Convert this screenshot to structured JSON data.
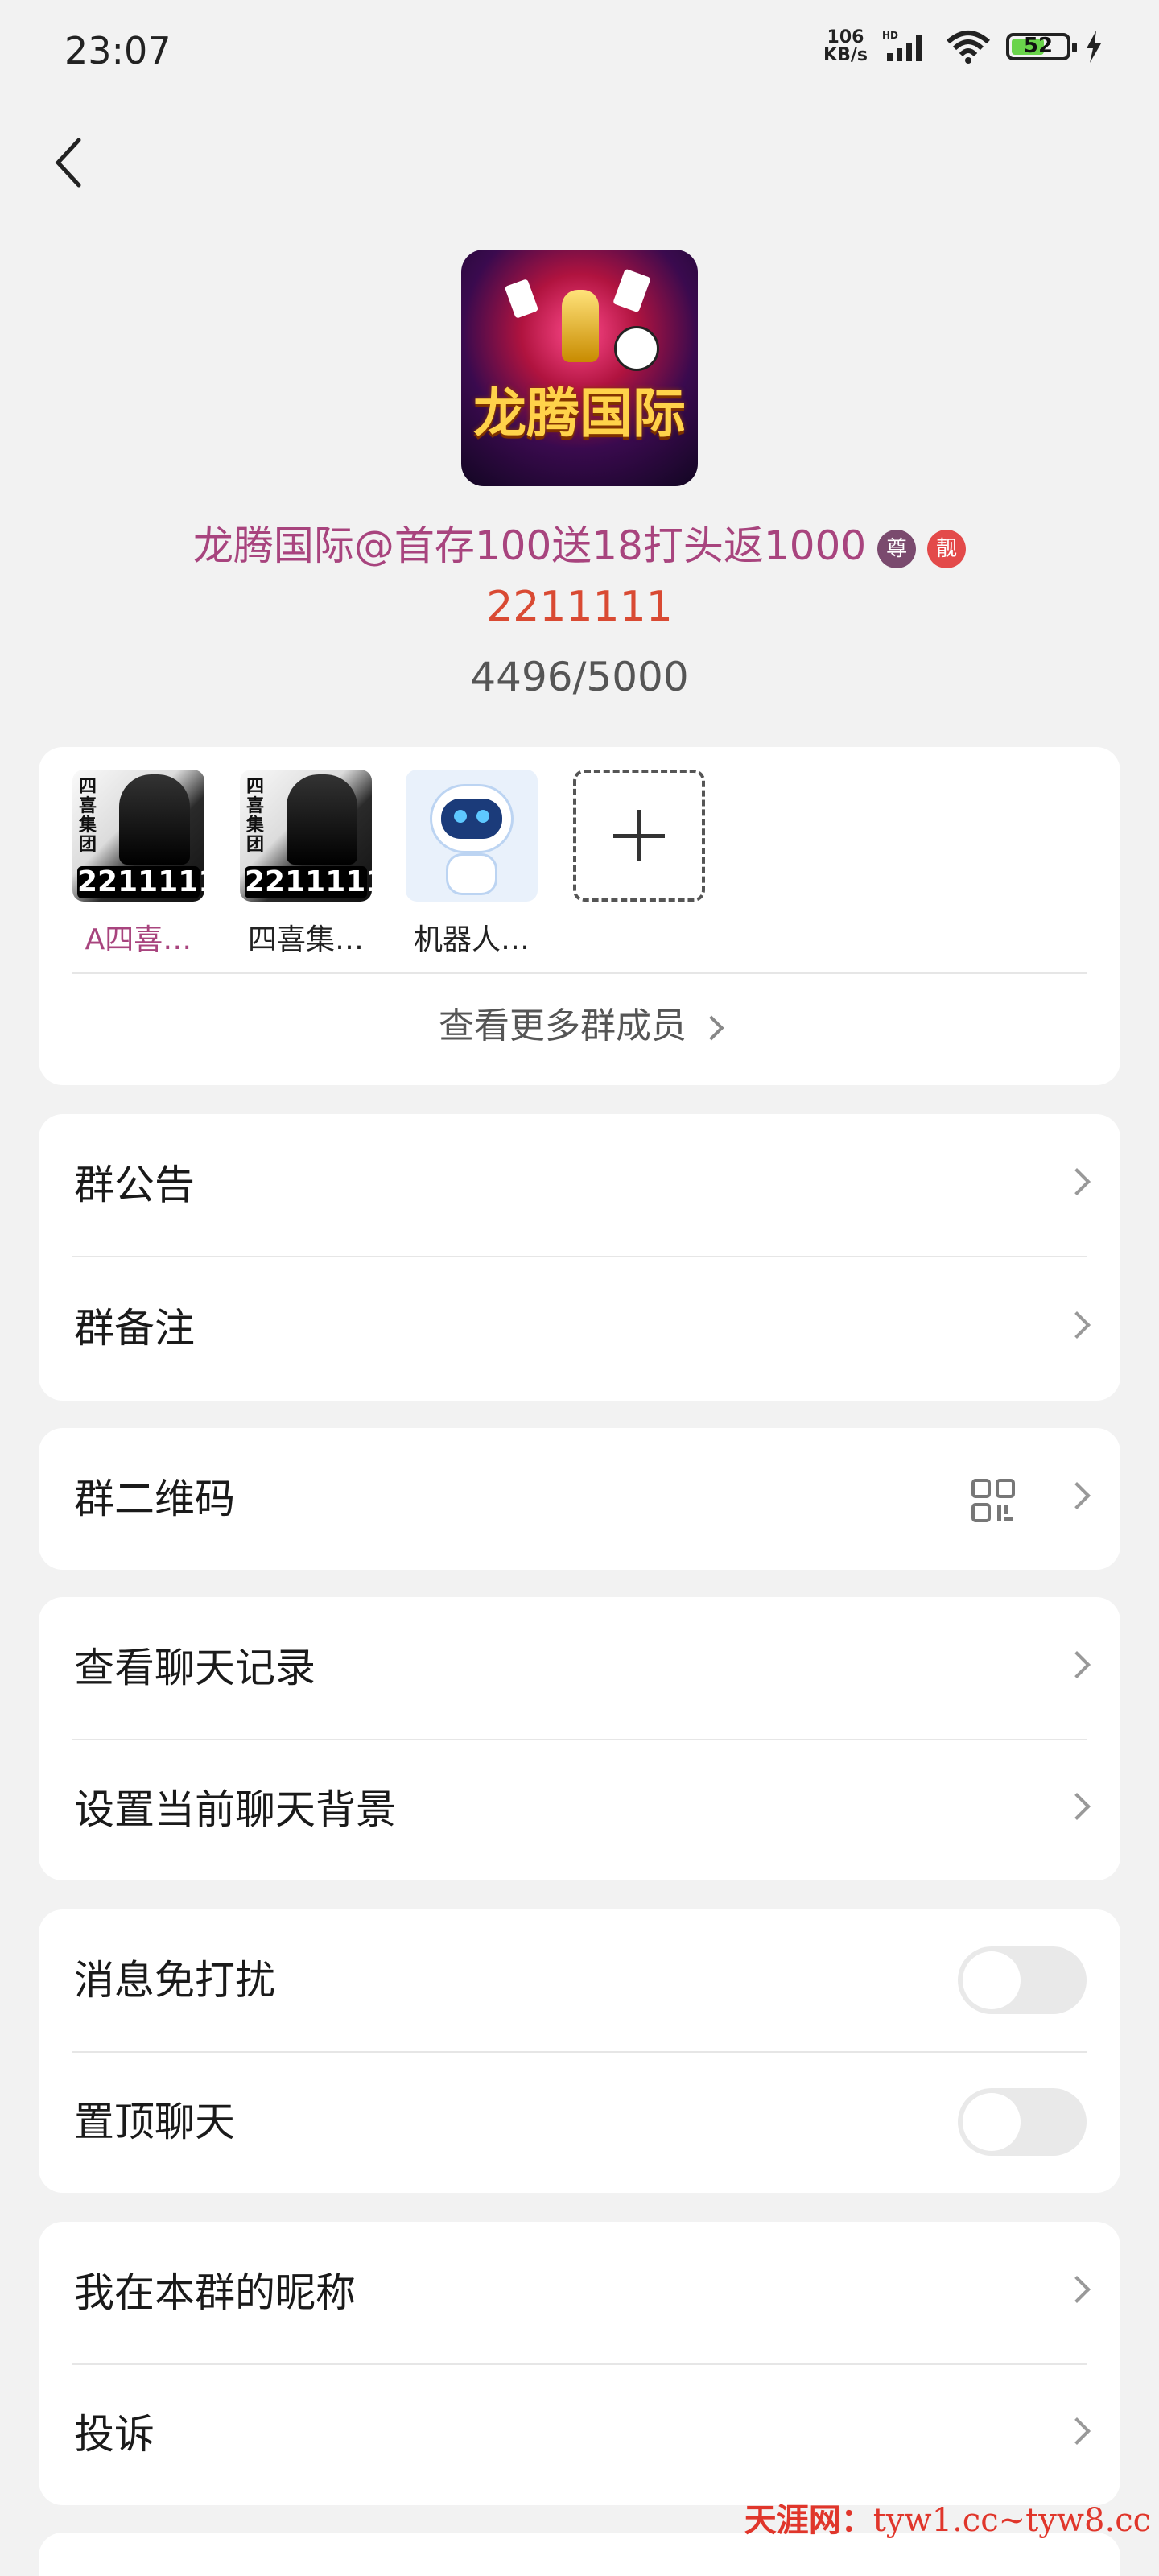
{
  "status_bar": {
    "time": "23:07",
    "net_speed_value": "106",
    "net_speed_unit": "KB/s",
    "hd": "HD",
    "battery": "52"
  },
  "group": {
    "avatar_text": "龙腾国际",
    "name": "龙腾国际@首存100送18打头返1000",
    "badge_1": "尊",
    "badge_2": "靓",
    "id": "2211111",
    "member_count": "4496/5000"
  },
  "members": {
    "items": [
      {
        "name": "A四喜…",
        "avatar_title": "四喜集团",
        "plate": "2211111"
      },
      {
        "name": "四喜集…",
        "avatar_title": "四喜集团",
        "plate": "2211111"
      },
      {
        "name": "机器人…"
      }
    ],
    "more_label": "查看更多群成员"
  },
  "menu": {
    "announcement": "群公告",
    "remark": "群备注",
    "qrcode": "群二维码",
    "chat_history": "查看聊天记录",
    "chat_background": "设置当前聊天背景",
    "mute": "消息免打扰",
    "pin": "置顶聊天",
    "nickname": "我在本群的昵称",
    "report": "投诉"
  },
  "toggles": {
    "mute_on": false,
    "pin_on": false
  },
  "watermark": {
    "cn": "天涯网：",
    "url": "tyw1.cc~tyw8.cc"
  },
  "colors": {
    "accent_pink": "#a8447e",
    "accent_red": "#d94a33",
    "background": "#f2f2f2"
  }
}
